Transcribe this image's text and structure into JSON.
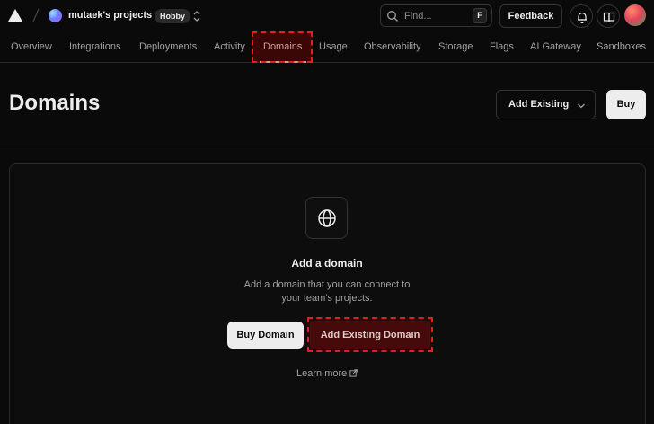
{
  "topbar": {
    "project_name": "mutaek's projects",
    "plan_badge": "Hobby",
    "search_placeholder": "Find...",
    "search_shortcut": "F",
    "feedback_label": "Feedback"
  },
  "nav": {
    "tabs": [
      {
        "label": "Overview"
      },
      {
        "label": "Integrations"
      },
      {
        "label": "Deployments"
      },
      {
        "label": "Activity"
      },
      {
        "label": "Domains"
      },
      {
        "label": "Usage"
      },
      {
        "label": "Observability"
      },
      {
        "label": "Storage"
      },
      {
        "label": "Flags"
      },
      {
        "label": "AI Gateway"
      },
      {
        "label": "Sandboxes"
      }
    ],
    "active_tab": "Domains"
  },
  "header": {
    "title": "Domains",
    "add_existing_label": "Add Existing",
    "buy_label": "Buy"
  },
  "empty_state": {
    "title": "Add a domain",
    "description": "Add a domain that you can connect to your team's projects.",
    "buy_domain_label": "Buy Domain",
    "add_existing_domain_label": "Add Existing Domain",
    "learn_more_label": "Learn more"
  },
  "colors": {
    "background": "#0a0a0a",
    "text": "#ededed",
    "muted": "#a1a1a1",
    "highlight": "#e02020"
  },
  "icons": [
    "vercel-logo-icon",
    "slash-icon",
    "chevron-updown-icon",
    "search-icon",
    "bell-icon",
    "book-icon",
    "chevron-down-icon",
    "globe-icon",
    "external-link-icon"
  ]
}
